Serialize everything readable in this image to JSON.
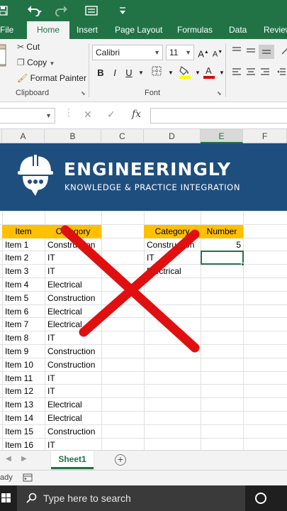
{
  "titlebar": {
    "save_icon": "save-icon",
    "undo_icon": "undo-icon",
    "redo_icon": "redo-icon",
    "form_icon": "form-icon",
    "customize_icon": "customize-qat-icon"
  },
  "tabs": [
    "File",
    "Home",
    "Insert",
    "Page Layout",
    "Formulas",
    "Data",
    "Review"
  ],
  "ribbon": {
    "clipboard": {
      "cut": "Cut",
      "copy": "Copy",
      "format_painter": "Format Painter",
      "label": "Clipboard"
    },
    "font": {
      "name": "Calibri",
      "size": "11",
      "bold": "B",
      "italic": "I",
      "underline": "U",
      "grow": "A",
      "shrink": "A",
      "label": "Font"
    }
  },
  "formula_bar": {
    "name_box": "",
    "fx": "fx",
    "cancel": "✕",
    "enter": "✓"
  },
  "columns": [
    "A",
    "B",
    "C",
    "D",
    "E",
    "F"
  ],
  "selected_column": "E",
  "banner": {
    "title": "ENGINEERINGLY",
    "subtitle": "KNOWLEDGE & PRACTICE INTEGRATION",
    "bg_color": "#1e4e7e"
  },
  "table_left": {
    "headers": [
      "Item",
      "Category"
    ],
    "rows": [
      [
        "Item 1",
        "Construction"
      ],
      [
        "Item 2",
        "IT"
      ],
      [
        "Item 3",
        "IT"
      ],
      [
        "Item 4",
        "Electrical"
      ],
      [
        "Item 5",
        "Construction"
      ],
      [
        "Item 6",
        "Electrical"
      ],
      [
        "Item 7",
        "Electrical"
      ],
      [
        "Item 8",
        "IT"
      ],
      [
        "Item 9",
        "Construction"
      ],
      [
        "Item 10",
        "Construction"
      ],
      [
        "Item 11",
        "IT"
      ],
      [
        "Item 12",
        "IT"
      ],
      [
        "Item 13",
        "Electrical"
      ],
      [
        "Item 14",
        "Electrical"
      ],
      [
        "Item 15",
        "Construction"
      ],
      [
        "Item 16",
        "IT"
      ]
    ]
  },
  "table_right": {
    "headers": [
      "Category",
      "Number"
    ],
    "rows": [
      [
        "Construction",
        "5"
      ],
      [
        "IT",
        ""
      ],
      [
        "Electrical",
        ""
      ]
    ]
  },
  "header_color": "#ffc000",
  "overlay_x_color": "#e01010",
  "sheet_tab": "Sheet1",
  "add_sheet": "+",
  "status": {
    "ready": "ady"
  },
  "taskbar": {
    "search_placeholder": "Type here to search"
  }
}
